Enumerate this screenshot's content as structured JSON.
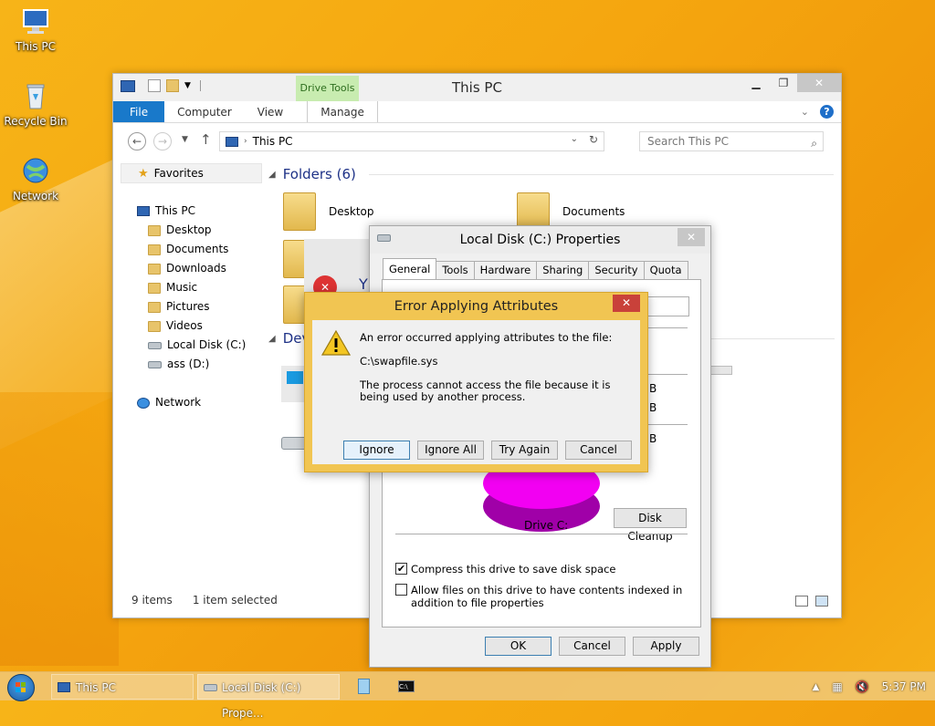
{
  "desktop": {
    "icons": [
      {
        "label": "This PC"
      },
      {
        "label": "Recycle Bin"
      },
      {
        "label": "Network"
      }
    ]
  },
  "explorer": {
    "title": "This PC",
    "contextual_tab": "Drive Tools",
    "tabs": {
      "file": "File",
      "computer": "Computer",
      "view": "View",
      "manage": "Manage"
    },
    "address": "This PC",
    "search_placeholder": "Search This PC",
    "nav": {
      "favorites": "Favorites",
      "this_pc": "This PC",
      "items": [
        "Desktop",
        "Documents",
        "Downloads",
        "Music",
        "Pictures",
        "Videos",
        "Local Disk (C:)",
        "ass (D:)"
      ],
      "network": "Network"
    },
    "folders_header": "Folders (6)",
    "devices_header": "Dev",
    "folders": {
      "desktop": "Desktop",
      "documents": "Documents"
    },
    "status": {
      "count": "9 items",
      "selected": "1 item selected"
    }
  },
  "properties": {
    "title": "Local Disk (C:) Properties",
    "tabs": [
      "General",
      "Tools",
      "Hardware",
      "Sharing",
      "Security",
      "Quota"
    ],
    "drive_label": "Drive C:",
    "cleanup": "Disk Cleanup",
    "compress": "Compress this drive to save disk space",
    "index": "Allow files on this drive to have contents indexed in addition to file properties",
    "ok": "OK",
    "cancel": "Cancel",
    "apply": "Apply",
    "partial_b1": "B",
    "partial_b2": "B",
    "partial_b3": "B"
  },
  "error": {
    "title": "Error Applying Attributes",
    "message": "An error occurred applying attributes to the file:",
    "file": "C:\\swapfile.sys",
    "detail": "The process cannot access the file because it is being used by another process.",
    "buttons": {
      "ignore": "Ignore",
      "ignore_all": "Ignore All",
      "try_again": "Try Again",
      "cancel": "Cancel"
    },
    "behind_letter": "Y"
  },
  "taskbar": {
    "items": [
      "This PC",
      "Local Disk (C:) Prope..."
    ],
    "time": "5:37 PM"
  }
}
